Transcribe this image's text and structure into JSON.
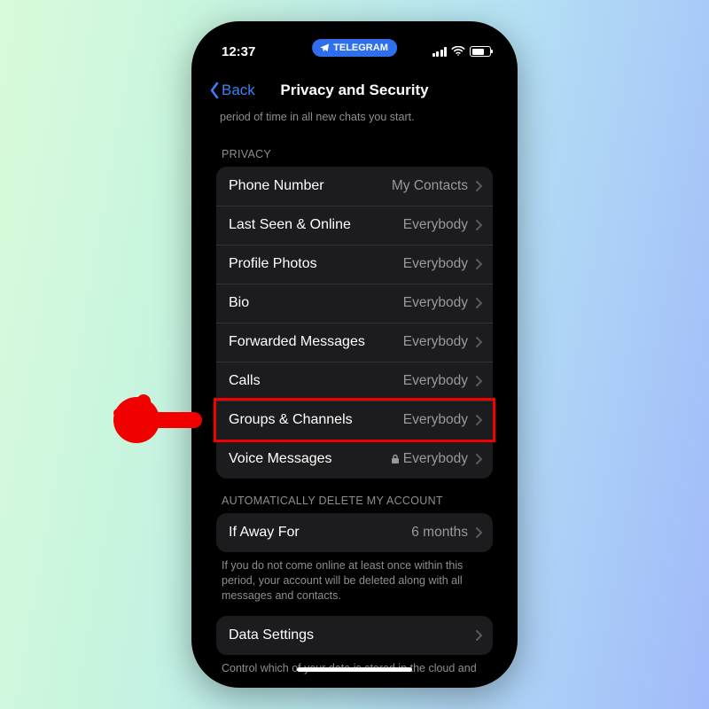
{
  "status": {
    "time": "12:37",
    "pill_label": "TELEGRAM"
  },
  "nav": {
    "back": "Back",
    "title": "Privacy and Security"
  },
  "clipped_desc": "period of time in all new chats you start.",
  "privacy": {
    "header": "PRIVACY",
    "items": [
      {
        "label": "Phone Number",
        "value": "My Contacts",
        "locked": false
      },
      {
        "label": "Last Seen & Online",
        "value": "Everybody",
        "locked": false
      },
      {
        "label": "Profile Photos",
        "value": "Everybody",
        "locked": false
      },
      {
        "label": "Bio",
        "value": "Everybody",
        "locked": false
      },
      {
        "label": "Forwarded Messages",
        "value": "Everybody",
        "locked": false
      },
      {
        "label": "Calls",
        "value": "Everybody",
        "locked": false
      },
      {
        "label": "Groups & Channels",
        "value": "Everybody",
        "locked": false
      },
      {
        "label": "Voice Messages",
        "value": "Everybody",
        "locked": true
      }
    ]
  },
  "delete": {
    "header": "AUTOMATICALLY DELETE MY ACCOUNT",
    "row_label": "If Away For",
    "row_value": "6 months",
    "footer": "If you do not come online at least once within this period, your account will be deleted along with all messages and contacts."
  },
  "data_sect": {
    "row_label": "Data Settings",
    "footer": "Control which of your data is stored in the cloud and used by Telegram to enable advanced features."
  },
  "annotation": {
    "highlighted_row_index": 6
  }
}
